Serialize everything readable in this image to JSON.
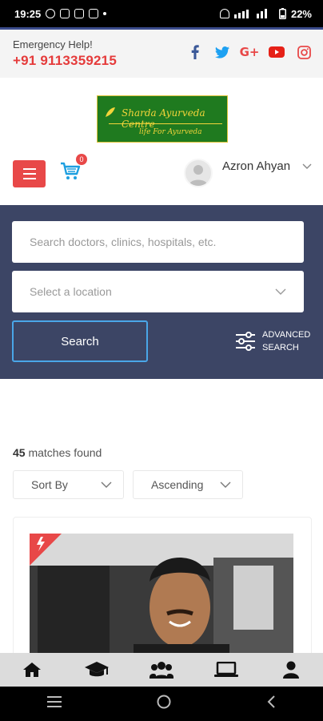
{
  "status_bar": {
    "time": "19:25",
    "battery": "22%"
  },
  "topbar": {
    "emergency_label": "Emergency Help!",
    "emergency_phone": "+91 9113359215",
    "socials": [
      {
        "icon": "facebook-icon",
        "glyph": "f",
        "color": "#3b5998"
      },
      {
        "icon": "twitter-icon",
        "glyph": "🐦",
        "color": "#1da1f2"
      },
      {
        "icon": "google-plus-icon",
        "glyph": "G+",
        "color": "#e84848"
      },
      {
        "icon": "youtube-icon",
        "glyph": "▶",
        "color": "#e62117"
      },
      {
        "icon": "instagram-icon",
        "glyph": "◎",
        "color": "#e84848"
      }
    ]
  },
  "logo": {
    "title": "Sharda Ayurveda Centre",
    "tagline": "life For Ayurveda"
  },
  "header": {
    "cart_count": "0",
    "user_name": "Azron Ahyan"
  },
  "search": {
    "placeholder": "Search doctors, clinics, hospitals, etc.",
    "location_placeholder": "Select a location",
    "button_label": "Search",
    "advanced_line1": "ADVANCED",
    "advanced_line2": "SEARCH"
  },
  "results": {
    "count": "45",
    "count_suffix": "matches found",
    "sort_label": "Sort By",
    "order_label": "Ascending"
  },
  "bottom_nav": [
    "home-icon",
    "graduation-cap-icon",
    "users-icon",
    "laptop-icon",
    "user-icon"
  ],
  "colors": {
    "accent_red": "#e84848",
    "panel_navy": "#3c4565",
    "button_border_blue": "#4aa6e8"
  }
}
